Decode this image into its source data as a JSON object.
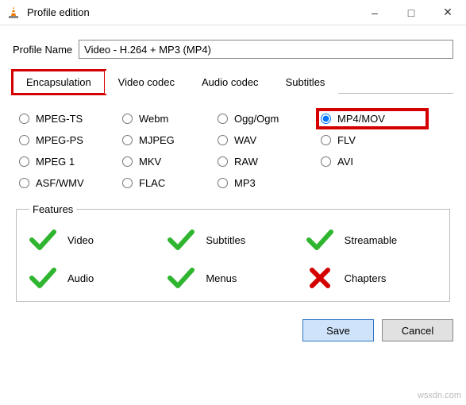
{
  "window": {
    "title": "Profile edition"
  },
  "profile": {
    "label": "Profile Name",
    "value": "Video - H.264 + MP3 (MP4)"
  },
  "tabs": {
    "encapsulation": "Encapsulation",
    "video_codec": "Video codec",
    "audio_codec": "Audio codec",
    "subtitles": "Subtitles"
  },
  "encaps": {
    "mpeg_ts": "MPEG-TS",
    "webm": "Webm",
    "ogg": "Ogg/Ogm",
    "mp4": "MP4/MOV",
    "mpeg_ps": "MPEG-PS",
    "mjpeg": "MJPEG",
    "wav": "WAV",
    "flv": "FLV",
    "mpeg1": "MPEG 1",
    "mkv": "MKV",
    "raw": "RAW",
    "avi": "AVI",
    "asf": "ASF/WMV",
    "flac": "FLAC",
    "mp3": "MP3"
  },
  "features": {
    "legend": "Features",
    "video": "Video",
    "subtitles": "Subtitles",
    "streamable": "Streamable",
    "audio": "Audio",
    "menus": "Menus",
    "chapters": "Chapters"
  },
  "buttons": {
    "save": "Save",
    "cancel": "Cancel"
  },
  "watermark": "wsxdn.com"
}
